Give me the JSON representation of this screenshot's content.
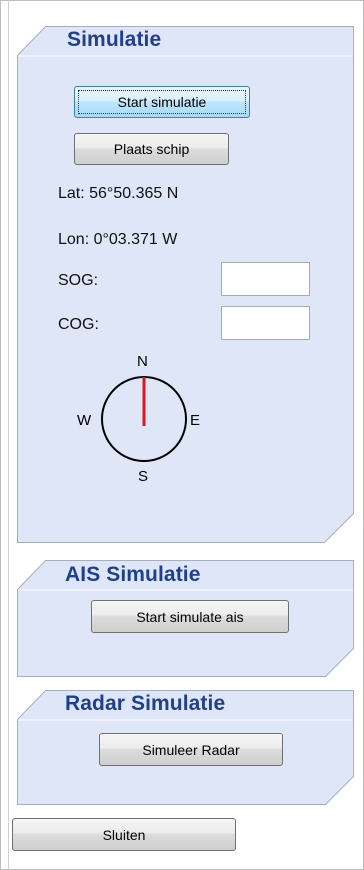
{
  "simulation": {
    "title": "Simulatie",
    "start_button": "Start simulatie",
    "place_ship_button": "Plaats schip",
    "lat": "Lat: 56°50.365 N",
    "lon": "Lon: 0°03.371 W",
    "sog_label": "SOG:",
    "sog_value": "",
    "cog_label": "COG:",
    "cog_value": "",
    "compass": {
      "north": "N",
      "east": "E",
      "south": "S",
      "west": "W",
      "needle_color": "#e0161c"
    }
  },
  "ais": {
    "title": "AIS Simulatie",
    "start_button": "Start simulate ais"
  },
  "radar": {
    "title": "Radar Simulatie",
    "simulate_button": "Simuleer Radar"
  },
  "close_button": "Sluiten",
  "colors": {
    "panel_fill": "#dfe6f7",
    "panel_border": "#a6afc2",
    "title_color": "#1f3f93"
  }
}
